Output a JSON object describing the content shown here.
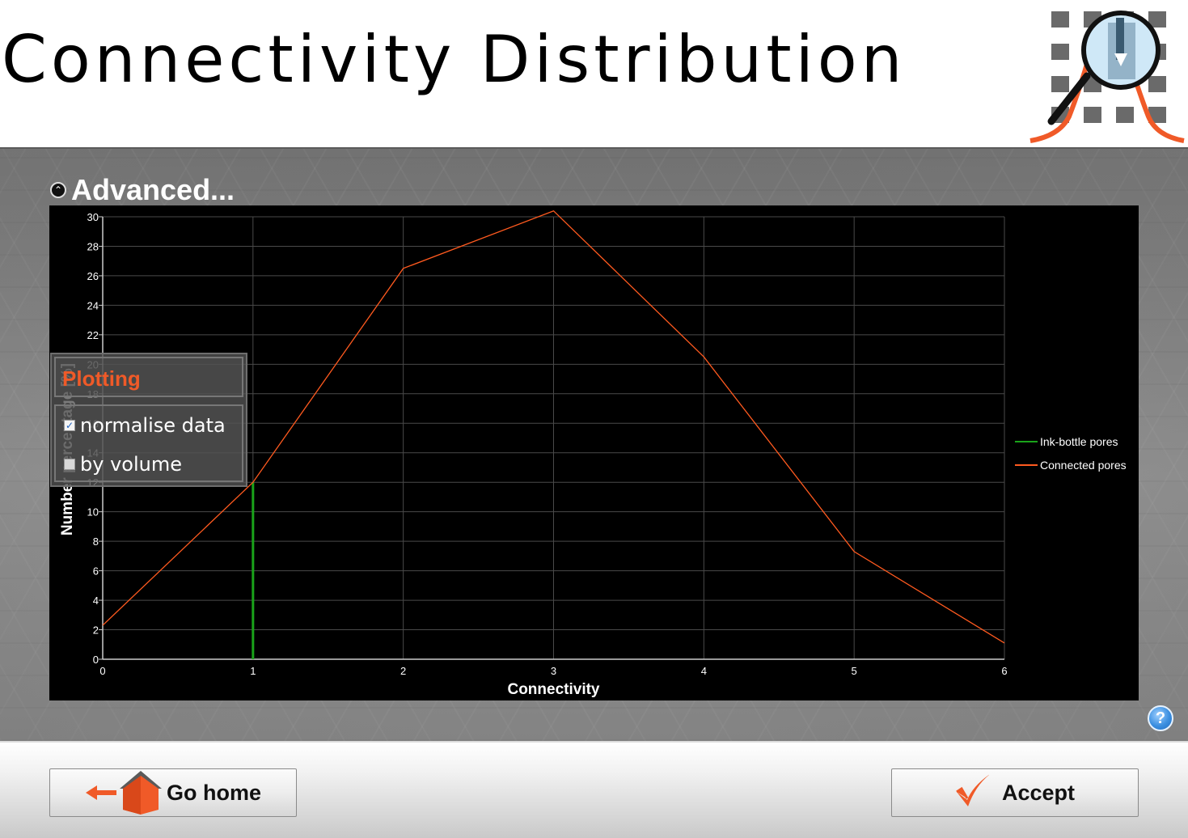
{
  "header": {
    "title": "Connectivity Distribution",
    "logo_icon": "magnifier-pore-icon"
  },
  "advanced": {
    "label": "Advanced...",
    "icon": "chevron-up-circle-icon"
  },
  "plotting_panel": {
    "title": "Plotting",
    "options": [
      {
        "label": "normalise data",
        "checked": true
      },
      {
        "label": "by volume",
        "checked": false
      }
    ]
  },
  "chart_data": {
    "type": "line",
    "title": "",
    "xlabel": "Connectivity",
    "ylabel": "Number percentage [%]",
    "xlim": [
      0,
      6
    ],
    "ylim": [
      0,
      30
    ],
    "x_ticks": [
      "0",
      "1",
      "2",
      "3",
      "4",
      "5",
      "6"
    ],
    "y_ticks": [
      "0",
      "2",
      "4",
      "6",
      "8",
      "10",
      "12",
      "14",
      "16",
      "18",
      "20",
      "22",
      "24",
      "26",
      "28",
      "30"
    ],
    "grid": true,
    "legend_position": "right",
    "series": [
      {
        "name": "Ink-bottle pores",
        "color": "#1aa31a",
        "x": [
          1,
          1
        ],
        "y": [
          0,
          12
        ]
      },
      {
        "name": "Connected pores",
        "color": "#ff5a1f",
        "x": [
          0,
          1,
          2,
          3,
          4,
          5,
          6
        ],
        "y": [
          2.3,
          12,
          26.5,
          30.4,
          20.5,
          7.3,
          1.1
        ]
      }
    ]
  },
  "help": {
    "label": "?",
    "icon": "help-icon"
  },
  "footer": {
    "go_home_label": "Go home",
    "go_home_icons": [
      "arrow-left-icon",
      "house-icon"
    ],
    "accept_label": "Accept",
    "accept_icon": "checkmark-icon",
    "accent_color": "#f05a28"
  }
}
